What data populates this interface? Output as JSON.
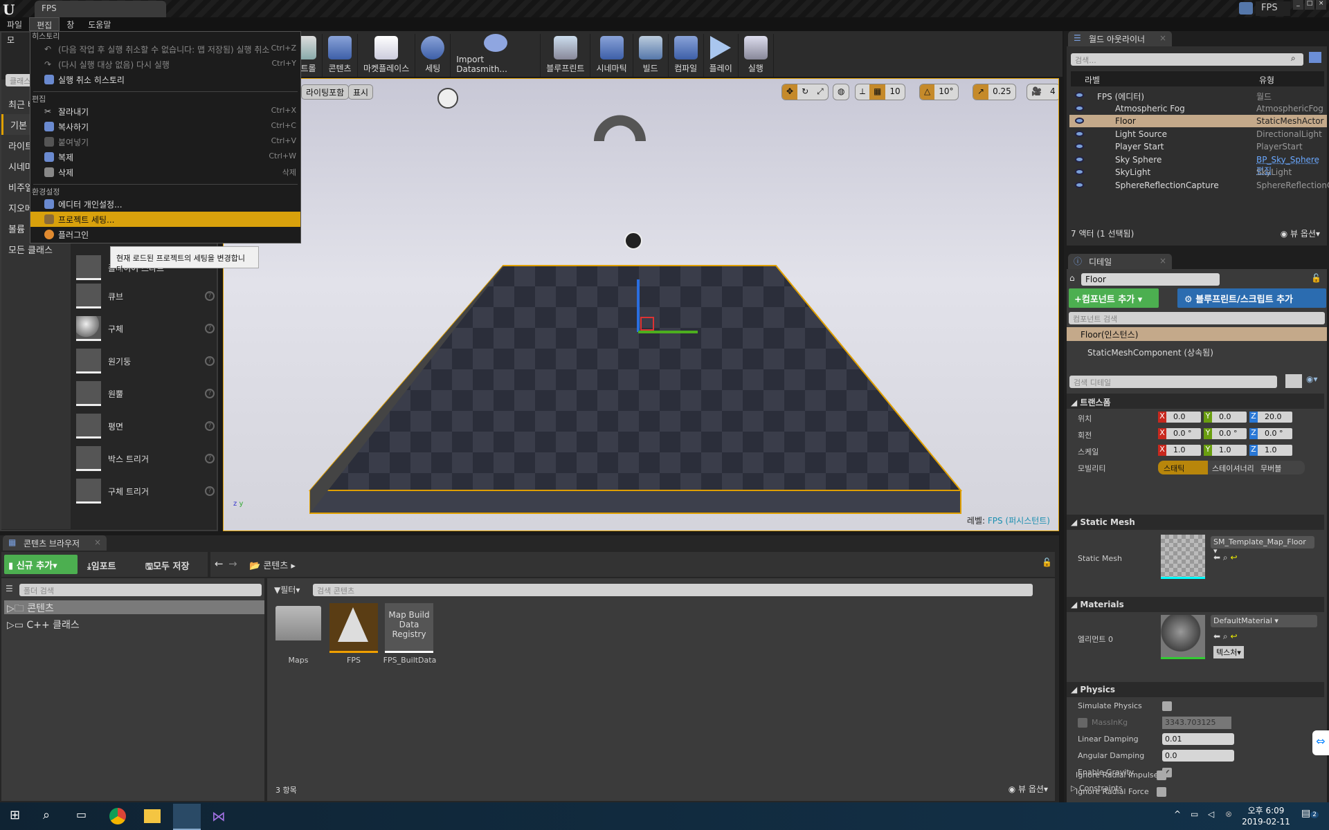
{
  "window": {
    "tab": "FPS",
    "top_right_label": "FPS"
  },
  "menubar": [
    "파일",
    "편집",
    "창",
    "도움말"
  ],
  "edit_menu": {
    "history_header": "히스토리",
    "history": [
      {
        "label": "(다음 작업 후 실행 취소할 수 없습니다: 맵 저장됨) 실행 취소",
        "shortcut": "Ctrl+Z",
        "disabled": true
      },
      {
        "label": "(다시 실행 대상 없음) 다시 실행",
        "shortcut": "Ctrl+Y",
        "disabled": true
      },
      {
        "label": "실행 취소 히스토리",
        "shortcut": "",
        "disabled": false
      }
    ],
    "edit_header": "편집",
    "edit": [
      {
        "label": "잘라내기",
        "shortcut": "Ctrl+X"
      },
      {
        "label": "복사하기",
        "shortcut": "Ctrl+C"
      },
      {
        "label": "붙여넣기",
        "shortcut": "Ctrl+V"
      },
      {
        "label": "복제",
        "shortcut": "Ctrl+W"
      },
      {
        "label": "삭제",
        "shortcut": "삭제"
      }
    ],
    "config_header": "환경설정",
    "config": [
      {
        "label": "에디터 개인설정..."
      },
      {
        "label": "프로젝트 세팅..."
      },
      {
        "label": "플러그인"
      }
    ],
    "tooltip": "현재 로드된 프로젝트의 세팅을 변경합니다."
  },
  "modes": {
    "tab_partial": "모",
    "search_placeholder": "클래스",
    "categories": [
      "최근 배치",
      "기본",
      "라이트",
      "시네마틱",
      "비주얼 이펙트",
      "지오메트리",
      "볼륨",
      "모든 클래스"
    ],
    "items": [
      "플레이어 스타트",
      "큐브",
      "구체",
      "원기둥",
      "원뿔",
      "평면",
      "박스 트리거",
      "구체 트리거"
    ]
  },
  "toolbar": [
    "컨트롤",
    "콘텐츠",
    "마켓플레이스",
    "세팅",
    "Import Datasmith...",
    "블루프린트",
    "시네마틱",
    "빌드",
    "컴파일",
    "플레이",
    "실행"
  ],
  "viewport": {
    "buttons": [
      "라이팅포함",
      "표시"
    ],
    "grid_snap": "10",
    "rot_snap": "10°",
    "scale_snap": "0.25",
    "cam_speed": "4",
    "level_label": "레벨:",
    "level_name": "FPS (퍼시스턴트)"
  },
  "outliner": {
    "tab": "월드 아웃라이너",
    "search_placeholder": "검색...",
    "col_label": "라벨",
    "col_type": "유형",
    "rows": [
      {
        "label": "FPS (에디터)",
        "type": "월드"
      },
      {
        "label": "Atmospheric Fog",
        "type": "AtmosphericFog"
      },
      {
        "label": "Floor",
        "type": "StaticMeshActor",
        "selected": true
      },
      {
        "label": "Light Source",
        "type": "DirectionalLight"
      },
      {
        "label": "Player Start",
        "type": "PlayerStart"
      },
      {
        "label": "Sky Sphere",
        "type": "BP_Sky_Sphere 편집",
        "link": true
      },
      {
        "label": "SkyLight",
        "type": "SkyLight"
      },
      {
        "label": "SphereReflectionCapture",
        "type": "SphereReflectionCapture"
      }
    ],
    "status": "7 액터 (1 선택됨)",
    "view_options": "뷰 옵션"
  },
  "details": {
    "tab": "디테일",
    "name": "Floor",
    "add_component": "컴포넌트 추가",
    "add_blueprint": "블루프린트/스크립트 추가",
    "component_search": "컴포넌트 검색",
    "instance": "Floor(인스턴스)",
    "component": "StaticMeshComponent (상속됨)",
    "search_placeholder": "검색 디테일",
    "transform": {
      "header": "트랜스폼",
      "location_label": "위치",
      "rotation_label": "회전",
      "scale_label": "스케일",
      "mobility_label": "모빌리티",
      "location": [
        "0.0",
        "0.0",
        "20.0"
      ],
      "rotation": [
        "0.0 °",
        "0.0 °",
        "0.0 °"
      ],
      "scale": [
        "1.0",
        "1.0",
        "1.0"
      ],
      "mobility": [
        "스태틱",
        "스테이셔너리",
        "무버블"
      ],
      "mobility_selected": "스태틱"
    },
    "static_mesh": {
      "header": "Static Mesh",
      "label": "Static Mesh",
      "value": "SM_Template_Map_Floor"
    },
    "materials": {
      "header": "Materials",
      "label": "엘리먼트 0",
      "value": "DefaultMaterial",
      "textures": "텍스처"
    },
    "physics": {
      "header": "Physics",
      "simulate": "Simulate Physics",
      "simulate_checked": false,
      "mass_label": "MassInKg",
      "mass": "3343.703125",
      "linear_label": "Linear Damping",
      "linear": "0.01",
      "angular_label": "Angular Damping",
      "angular": "0.0",
      "gravity_label": "Enable Gravity",
      "gravity_checked": true,
      "constraints": "Constraints",
      "radial_impulse": "Ignore Radial Impulse",
      "radial_force": "Ignore Radial Force"
    }
  },
  "content_browser": {
    "tab": "콘텐츠 브라우저",
    "add_new": "신규 추가",
    "import": "임포트",
    "save_all": "모두 저장",
    "path": "콘텐츠",
    "folder_search": "폴더 검색",
    "filter": "필터",
    "content_search": "검색 콘텐츠",
    "tree": [
      "콘텐츠",
      "C++ 클래스"
    ],
    "assets": [
      {
        "name": "Maps",
        "kind": "folder"
      },
      {
        "name": "FPS",
        "kind": "level"
      },
      {
        "name": "FPS_BuiltData",
        "kind": "data",
        "thumb": "Map Build Data Registry"
      }
    ],
    "count": "3 항목",
    "view_options": "뷰 옵션"
  },
  "taskbar": {
    "time": "오후 6:09",
    "date": "2019-02-11",
    "notifications": "2"
  },
  "colors": {
    "accent": "#d9a10c",
    "selection": "#c4a98a",
    "add_green": "#4caf50",
    "blueprint_blue": "#2b6cb0"
  }
}
